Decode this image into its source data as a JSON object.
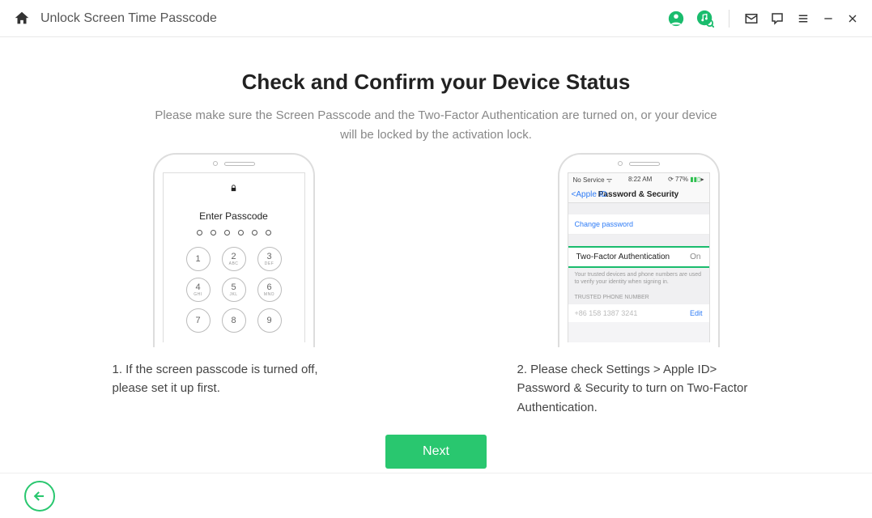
{
  "titlebar": {
    "title": "Unlock Screen Time Passcode"
  },
  "main": {
    "headline": "Check and Confirm your Device Status",
    "subhead": "Please make sure the Screen Passcode and the Two-Factor Authentication are turned on, or your device will be locked by the activation lock."
  },
  "left": {
    "enter_passcode": "Enter Passcode",
    "keys": {
      "k1": "1",
      "k2": "2",
      "k2s": "ABC",
      "k3": "3",
      "k3s": "DEF",
      "k4": "4",
      "k4s": "GHI",
      "k5": "5",
      "k5s": "JKL",
      "k6": "6",
      "k6s": "MNO",
      "k7": "7",
      "k8": "8",
      "k9": "9"
    },
    "caption": "1. If the screen passcode is turned off, please set it up first."
  },
  "right": {
    "status_left": "No Service",
    "status_time": "8:22 AM",
    "status_batt": "77%",
    "back_label": "Apple ID",
    "nav_title": "Password & Security",
    "change_password": "Change password",
    "tfa_label": "Two-Factor Authentication",
    "tfa_value": "On",
    "trusted_desc": "Your trusted devices and phone numbers are used to verify your identity when signing in.",
    "trusted_header": "TRUSTED PHONE NUMBER",
    "edit": "Edit",
    "phone_number": "+86 158 1387 3241",
    "caption": "2. Please check Settings > Apple ID> Password & Security to turn on Two-Factor Authentication."
  },
  "buttons": {
    "next": "Next"
  }
}
